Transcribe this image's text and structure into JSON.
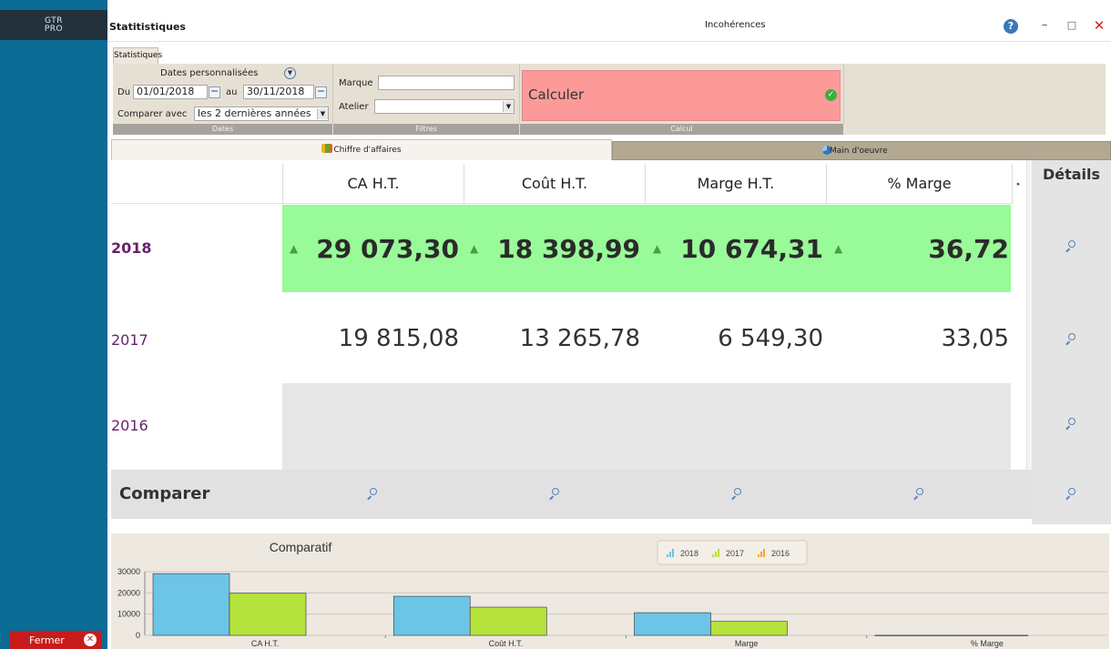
{
  "app": {
    "logo_line1": "GTR",
    "logo_line2": "PRO",
    "close_label": "Fermer"
  },
  "window": {
    "title": "Statitistiques",
    "center_label": "Incohérences",
    "help_glyph": "?",
    "min_glyph": "–",
    "max_glyph": "□",
    "close_glyph": "✕"
  },
  "toolbar": {
    "tab_label": "Statistiques",
    "dates": {
      "custom_label": "Dates personnalisées",
      "from_label": "Du",
      "from_value": "01/01/2018",
      "to_label": "au",
      "to_value": "30/11/2018",
      "compare_label": "Comparer avec",
      "compare_value": "les 2 dernières années",
      "group_label": "Dates"
    },
    "filters": {
      "brand_label": "Marque",
      "brand_value": "",
      "workshop_label": "Atelier",
      "workshop_value": "",
      "group_label": "Filtres"
    },
    "calc": {
      "button_label": "Calculer",
      "group_label": "Calcul"
    }
  },
  "tabs": {
    "revenue": "Chiffre d'affaires",
    "labor": "Main d'oeuvre"
  },
  "grid": {
    "headers": [
      "CA H.T.",
      "Coût H.T.",
      "Marge H.T.",
      "% Marge"
    ],
    "details_label": "Détails",
    "compare_label": "Comparer",
    "rows": [
      {
        "year": "2018",
        "values": [
          "29 073,30",
          "18 398,99",
          "10 674,31",
          "36,72"
        ],
        "highlight": true
      },
      {
        "year": "2017",
        "values": [
          "19 815,08",
          "13 265,78",
          "6 549,30",
          "33,05"
        ],
        "highlight": false
      },
      {
        "year": "2016",
        "values": [
          "",
          "",
          "",
          ""
        ],
        "highlight": false
      }
    ],
    "up_arrow": "▲",
    "highlight_color": "#98fa98",
    "year_color": "#6b1f6b"
  },
  "chart_data": {
    "type": "bar",
    "title": "Comparatif",
    "categories": [
      "CA H.T.",
      "Coût H.T.",
      "Marge",
      "% Marge"
    ],
    "series": [
      {
        "name": "2018",
        "color": "#6cc4e6",
        "values": [
          29073.3,
          18398.99,
          10674.31,
          36.72
        ]
      },
      {
        "name": "2017",
        "color": "#b6e23c",
        "values": [
          19815.08,
          13265.78,
          6549.3,
          33.05
        ]
      },
      {
        "name": "2016",
        "color": "#f6a630",
        "values": [
          0,
          0,
          0,
          0
        ]
      }
    ],
    "yticks": [
      "30000",
      "20000",
      "10000",
      "0"
    ],
    "ylim": [
      0,
      30000
    ],
    "grid": true,
    "legend": "top-center"
  }
}
